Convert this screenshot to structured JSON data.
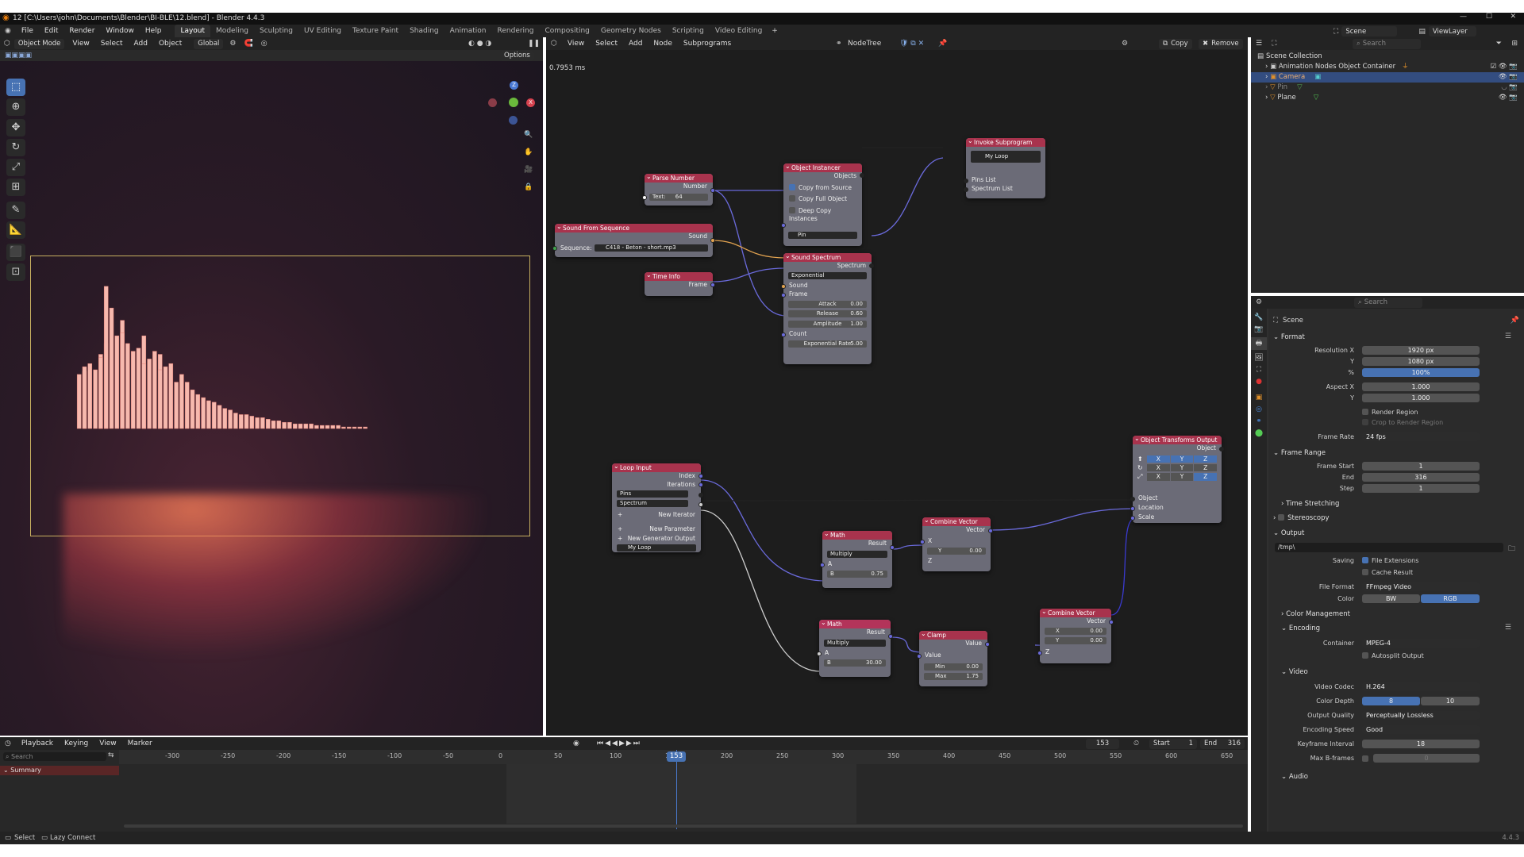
{
  "window": {
    "title": "12 [C:\\Users\\john\\Documents\\Blender\\BI-BLE\\12.blend] - Blender 4.4.3"
  },
  "menu": [
    "File",
    "Edit",
    "Render",
    "Window",
    "Help"
  ],
  "workspaces": [
    "Layout",
    "Modeling",
    "Sculpting",
    "UV Editing",
    "Texture Paint",
    "Shading",
    "Animation",
    "Rendering",
    "Compositing",
    "Geometry Nodes",
    "Scripting",
    "Video Editing"
  ],
  "scene": {
    "name": "Scene",
    "viewlayer": "ViewLayer"
  },
  "viewport": {
    "mode": "Object Mode",
    "menus": [
      "View",
      "Select",
      "Add",
      "Object"
    ],
    "orientation": "Global",
    "options": "Options",
    "bars": [
      [
        0.09,
        0.35
      ],
      [
        0.1,
        0.37
      ],
      [
        0.1,
        0.4
      ],
      [
        0.11,
        0.42
      ],
      [
        0.12,
        0.38
      ],
      [
        0.13,
        0.48
      ],
      [
        0.13,
        0.46
      ],
      [
        0.14,
        0.55
      ],
      [
        0.14,
        0.92
      ],
      [
        0.15,
        0.78
      ],
      [
        0.16,
        0.6
      ],
      [
        0.17,
        0.7
      ],
      [
        0.17,
        0.62
      ],
      [
        0.18,
        0.55
      ],
      [
        0.19,
        0.5
      ],
      [
        0.2,
        0.52
      ],
      [
        0.21,
        0.6
      ],
      [
        0.21,
        0.42
      ],
      [
        0.22,
        0.45
      ],
      [
        0.23,
        0.5
      ],
      [
        0.24,
        0.48
      ],
      [
        0.24,
        0.38
      ],
      [
        0.25,
        0.4
      ],
      [
        0.26,
        0.42
      ],
      [
        0.27,
        0.3
      ],
      [
        0.28,
        0.35
      ],
      [
        0.29,
        0.3
      ],
      [
        0.3,
        0.25
      ],
      [
        0.31,
        0.22
      ],
      [
        0.32,
        0.2
      ],
      [
        0.33,
        0.18
      ],
      [
        0.34,
        0.17
      ],
      [
        0.35,
        0.15
      ],
      [
        0.36,
        0.13
      ],
      [
        0.37,
        0.12
      ],
      [
        0.38,
        0.1
      ],
      [
        0.39,
        0.09
      ],
      [
        0.4,
        0.09
      ],
      [
        0.41,
        0.08
      ],
      [
        0.42,
        0.07
      ],
      [
        0.43,
        0.07
      ],
      [
        0.44,
        0.06
      ],
      [
        0.45,
        0.05
      ],
      [
        0.46,
        0.05
      ],
      [
        0.47,
        0.04
      ],
      [
        0.48,
        0.04
      ],
      [
        0.49,
        0.03
      ],
      [
        0.5,
        0.03
      ],
      [
        0.51,
        0.03
      ],
      [
        0.52,
        0.03
      ],
      [
        0.53,
        0.02
      ],
      [
        0.54,
        0.02
      ],
      [
        0.55,
        0.02
      ],
      [
        0.56,
        0.02
      ],
      [
        0.57,
        0.02
      ],
      [
        0.58,
        0.01
      ],
      [
        0.59,
        0.01
      ],
      [
        0.6,
        0.01
      ],
      [
        0.61,
        0.01
      ],
      [
        0.62,
        0.01
      ]
    ]
  },
  "nodeeditor": {
    "menus": [
      "View",
      "Select",
      "Add",
      "Node",
      "Subprograms"
    ],
    "tree": "NodeTree",
    "copy": "Copy",
    "remove": "Remove",
    "timing": "0.7953 ms"
  },
  "nodes": {
    "invoke": {
      "title": "Invoke Subprogram",
      "loop": "My Loop",
      "pins": "Pins List",
      "spectrum": "Spectrum List"
    },
    "instancer": {
      "title": "Object Instancer",
      "objects": "Objects",
      "copy_src": "Copy from Source",
      "copy_full": "Copy Full Object",
      "deep": "Deep Copy",
      "instances": "Instances",
      "pin": "Pin"
    },
    "parse": {
      "title": "Parse Number",
      "number": "Number",
      "text_lbl": "Text:",
      "text_val": "64"
    },
    "soundseq": {
      "title": "Sound From Sequence",
      "sound": "Sound",
      "seq_lbl": "Sequence:",
      "seq_val": "C418 - Beton - short.mp3"
    },
    "spectrum": {
      "title": "Sound Spectrum",
      "spectrum": "Spectrum",
      "mode": "Exponential",
      "sound": "Sound",
      "frame": "Frame",
      "attack": "Attack",
      "attack_v": "0.00",
      "release": "Release",
      "release_v": "0.60",
      "amplitude": "Amplitude",
      "amplitude_v": "1.00",
      "count": "Count",
      "exp": "Exponential Rate",
      "exp_v": "5.00"
    },
    "timeinfo": {
      "title": "Time Info",
      "frame": "Frame"
    },
    "loopinput": {
      "title": "Loop Input",
      "index": "Index",
      "iterations": "Iterations",
      "pins": "Pins",
      "spectrum": "Spectrum",
      "new_iter": "New Iterator",
      "new_param": "New Parameter",
      "new_gen": "New Generator Output",
      "loop": "My Loop"
    },
    "math1": {
      "title": "Math",
      "result": "Result",
      "op": "Multiply",
      "a": "A",
      "b": "B",
      "b_v": "0.75"
    },
    "math2": {
      "title": "Math",
      "result": "Result",
      "op": "Multiply",
      "a": "A",
      "b": "B",
      "b_v": "30.00"
    },
    "combine1": {
      "title": "Combine Vector",
      "vector": "Vector",
      "x": "X",
      "y": "Y",
      "y_v": "0.00",
      "z": "Z"
    },
    "combine2": {
      "title": "Combine Vector",
      "vector": "Vector",
      "x": "X",
      "x_v": "0.00",
      "y": "Y",
      "y_v": "0.00",
      "z": "Z"
    },
    "clamp": {
      "title": "Clamp",
      "value": "Value",
      "vin": "Value",
      "min": "Min",
      "min_v": "0.00",
      "max": "Max",
      "max_v": "1.75"
    },
    "transforms": {
      "title": "Object Transforms Output",
      "object": "Object",
      "objectin": "Object",
      "location": "Location",
      "scale": "Scale",
      "x": "X",
      "y": "Y",
      "z": "Z"
    }
  },
  "outliner": {
    "search": "Search",
    "root": "Scene Collection",
    "items": [
      "Animation Nodes Object Container",
      "Camera",
      "Pin",
      "Plane"
    ]
  },
  "properties": {
    "search": "Search",
    "scene": "Scene",
    "format": "Format",
    "resx_l": "Resolution X",
    "resx": "1920 px",
    "resy_l": "Y",
    "resy": "1080 px",
    "pct_l": "%",
    "pct": "100%",
    "aspx_l": "Aspect X",
    "aspx": "1.000",
    "aspy_l": "Y",
    "aspy": "1.000",
    "render_region": "Render Region",
    "crop": "Crop to Render Region",
    "fps_l": "Frame Rate",
    "fps": "24 fps",
    "range": "Frame Range",
    "fs_l": "Frame Start",
    "fs": "1",
    "fe_l": "End",
    "fe": "316",
    "step_l": "Step",
    "step": "1",
    "stretch": "Time Stretching",
    "stereo": "Stereoscopy",
    "output": "Output",
    "path": "/tmp\\",
    "saving_l": "Saving",
    "ext": "File Extensions",
    "cache": "Cache Result",
    "ff_l": "File Format",
    "ff": "FFmpeg Video",
    "color_l": "Color",
    "bw": "BW",
    "rgb": "RGB",
    "cm": "Color Management",
    "encoding": "Encoding",
    "container_l": "Container",
    "container": "MPEG-4",
    "autosplit": "Autosplit Output",
    "video": "Video",
    "codec_l": "Video Codec",
    "codec": "H.264",
    "depth_l": "Color Depth",
    "depth8": "8",
    "depth10": "10",
    "quality_l": "Output Quality",
    "quality": "Perceptually Lossless",
    "speed_l": "Encoding Speed",
    "speed": "Good",
    "kf_l": "Keyframe Interval",
    "kf": "18",
    "bf_l": "Max B-frames",
    "bf": "0",
    "audio": "Audio"
  },
  "timeline": {
    "menus": [
      "Playback",
      "Keying",
      "View",
      "Marker"
    ],
    "current": "153",
    "start_l": "Start",
    "start": "1",
    "end_l": "End",
    "end": "316",
    "search": "Search",
    "summary": "Summary",
    "ticks": [
      "-300",
      "-250",
      "-200",
      "-150",
      "-100",
      "-50",
      "0",
      "50",
      "100",
      "150",
      "200",
      "250",
      "300",
      "350",
      "400",
      "450",
      "500",
      "550",
      "600",
      "650"
    ]
  },
  "status": {
    "select": "Select",
    "lazy": "Lazy Connect",
    "version": "4.4.3"
  }
}
